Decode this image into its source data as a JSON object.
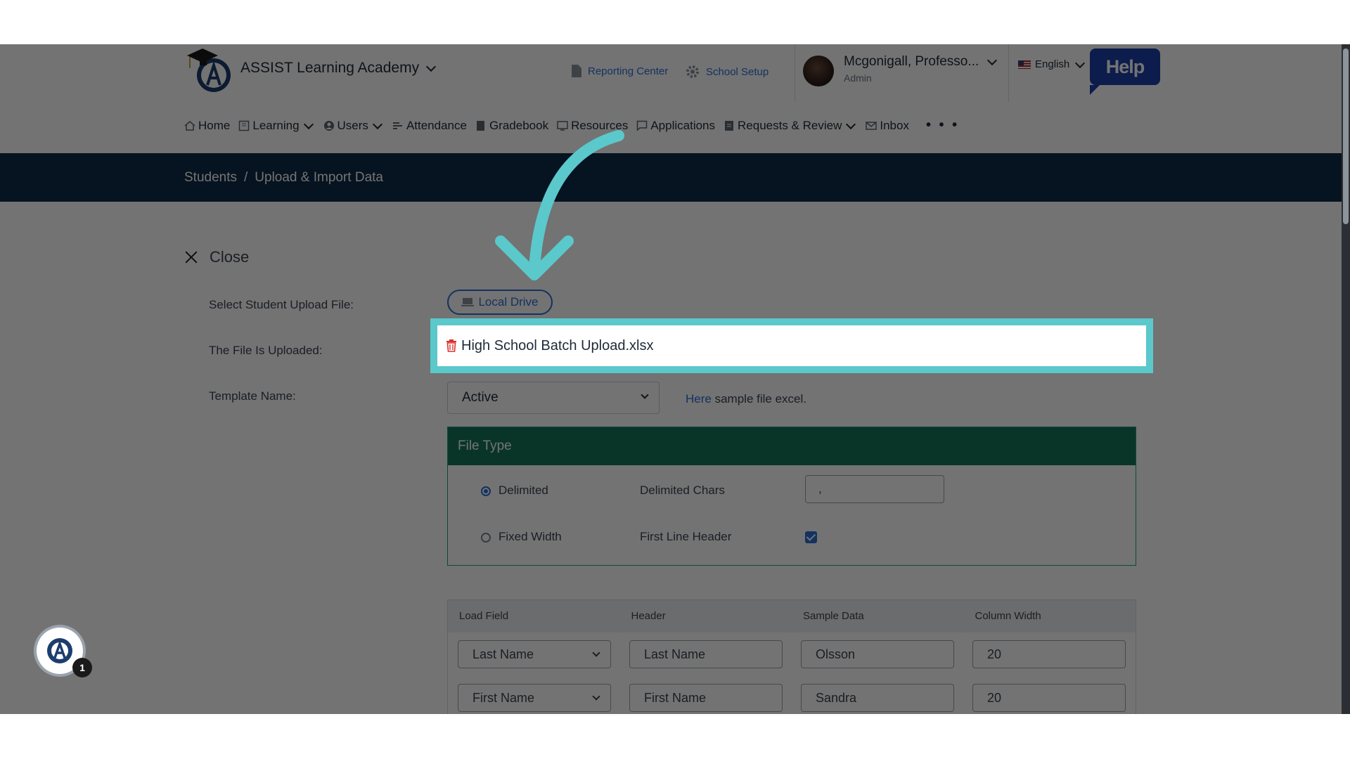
{
  "header": {
    "school_name": "ASSIST Learning Academy",
    "reporting_center": "Reporting Center",
    "school_setup": "School Setup",
    "user_name": "Mcgonigall, Professo...",
    "user_role": "Admin",
    "language": "English",
    "help": "Help"
  },
  "nav": {
    "items": [
      {
        "label": "Home"
      },
      {
        "label": "Learning"
      },
      {
        "label": "Users"
      },
      {
        "label": "Attendance"
      },
      {
        "label": "Gradebook"
      },
      {
        "label": "Resources"
      },
      {
        "label": "Applications"
      },
      {
        "label": "Requests & Review"
      },
      {
        "label": "Inbox"
      }
    ],
    "more": "• • •"
  },
  "breadcrumb": {
    "parent": "Students",
    "separator": "/",
    "current": "Upload & Import Data"
  },
  "form": {
    "close_label": "Close",
    "select_file_label": "Select Student Upload File:",
    "local_drive": "Local Drive",
    "uploaded_label": "The File Is Uploaded:",
    "file_name": "High School Batch Upload.xlsx",
    "template_label": "Template Name:",
    "template_value": "Active",
    "sample_link": "Here",
    "sample_text": "sample file excel."
  },
  "file_type": {
    "title": "File Type",
    "delimited": "Delimited",
    "fixed_width": "Fixed Width",
    "delimited_chars_label": "Delimited Chars",
    "delimited_chars_value": ",",
    "first_line_header_label": "First Line Header",
    "first_line_header_checked": true,
    "selected": "Delimited"
  },
  "mapping": {
    "headers": [
      "Load Field",
      "Header",
      "Sample Data",
      "Column Width"
    ],
    "rows": [
      {
        "load_field": "Last Name",
        "header": "Last Name",
        "sample": "Olsson",
        "width": "20"
      },
      {
        "load_field": "First Name",
        "header": "First Name",
        "sample": "Sandra",
        "width": "20"
      }
    ]
  },
  "chat": {
    "badge": "1"
  },
  "colors": {
    "accent": "#5bc8cc",
    "nav_bar": "#0e2a47",
    "panel_header": "#14755a",
    "link": "#2a6fd6"
  }
}
